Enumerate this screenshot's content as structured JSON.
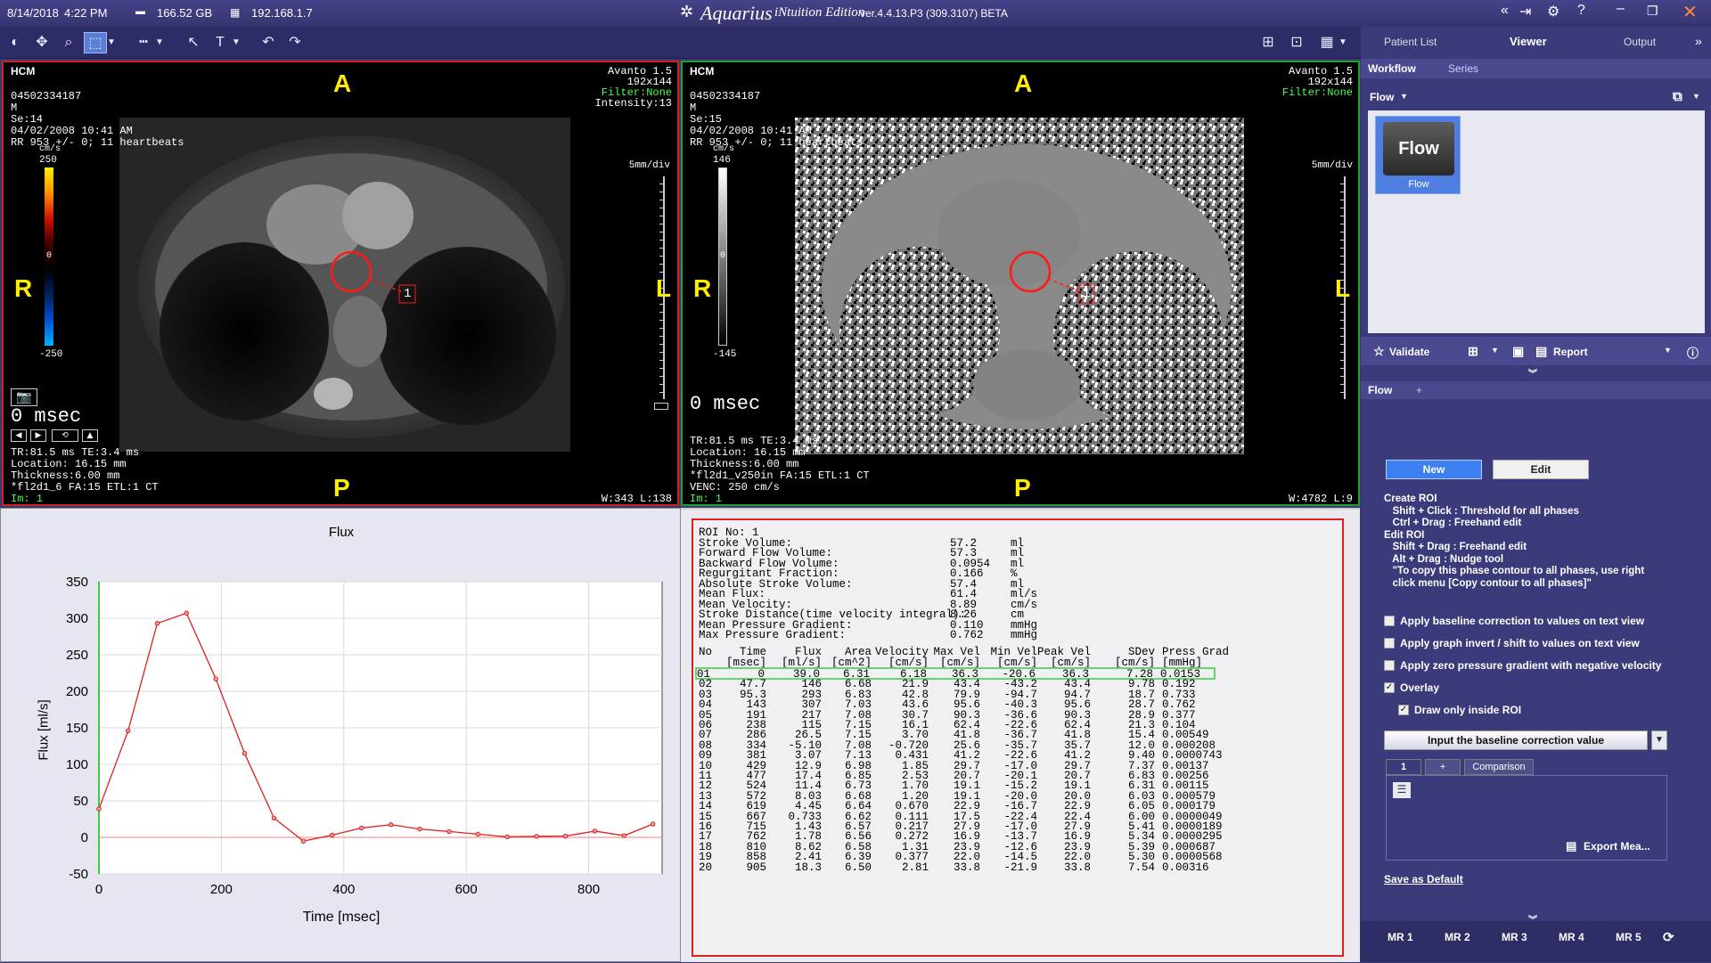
{
  "topbar": {
    "date": "8/14/2018",
    "time": "4:22 PM",
    "disk": "166.52 GB",
    "ip": "192.168.1.7",
    "app_title": "Aquarius",
    "app_sub": "iNtuition Edition",
    "version": "ver.4.4.13.P3 (309.3107) BETA"
  },
  "nav_tabs": {
    "patient_list": "Patient List",
    "viewer": "Viewer",
    "output": "Output"
  },
  "vp1": {
    "title": "HCM",
    "id": "04502334187",
    "sex": "M",
    "se": "Se:14",
    "date": "04/02/2008 10:41 AM",
    "rr": "RR 953 +/- 0; 11 heartbeats",
    "unit": "cm/s",
    "scale_top": "250",
    "scale_mid": "0",
    "scale_bot": "-250",
    "device": "Avanto 1.5",
    "matrix": "192x144",
    "filter": "Filter:None",
    "intensity": "Intensity:13",
    "msec": "0 msec",
    "tr": "TR:81.5 ms TE:3.4 ms",
    "location": "Location: 16.15 mm",
    "thickness": "Thickness:6.00 mm",
    "seq": "*fl2d1_6 FA:15 ETL:1 CT",
    "im": "Im: 1",
    "wl": "W:343 L:138",
    "scale_label": "5mm/div",
    "A": "A",
    "P": "P",
    "R": "R",
    "L": "L",
    "roi": "1"
  },
  "vp2": {
    "title": "HCM",
    "id": "04502334187",
    "sex": "M",
    "se": "Se:15",
    "date": "04/02/2008 10:41 AM",
    "rr": "RR 953 +/- 0; 11 heartbeats",
    "unit": "cm/s",
    "scale_top": "146",
    "scale_mid": "0",
    "scale_bot": "-145",
    "device": "Avanto 1.5",
    "matrix": "192x144",
    "filter": "Filter:None",
    "msec": "0 msec",
    "tr": "TR:81.5 ms TE:3.4 ms",
    "location": "Location: 16.15 mm",
    "thickness": "Thickness:6.00 mm",
    "seq": "*fl2d1_v250in FA:15 ETL:1 CT",
    "venc": "VENC: 250 cm/s",
    "im": "Im: 1",
    "wl": "W:4782 L:9",
    "scale_label": "5mm/div",
    "A": "A",
    "P": "P",
    "R": "R",
    "L": "L",
    "roi": "1"
  },
  "chart_data": {
    "type": "line",
    "title": "Flux",
    "xlabel": "Time [msec]",
    "ylabel": "Flux [ml/s]",
    "xlim": [
      0,
      920
    ],
    "ylim": [
      -50,
      350
    ],
    "xticks": [
      0,
      200,
      400,
      600,
      800
    ],
    "yticks": [
      -50,
      0,
      50,
      100,
      150,
      200,
      250,
      300,
      350
    ],
    "x": [
      0,
      47.7,
      95.3,
      143,
      191,
      238,
      286,
      334,
      381,
      429,
      477,
      524,
      572,
      619,
      667,
      715,
      762,
      810,
      858,
      905
    ],
    "series": [
      {
        "values": [
          39.0,
          146,
          293,
          307,
          217,
          115,
          26.5,
          -5.1,
          3.07,
          12.9,
          17.4,
          11.4,
          8.03,
          4.45,
          0.733,
          1.43,
          1.78,
          8.62,
          2.41,
          18.3
        ]
      }
    ]
  },
  "stats": [
    {
      "label": "ROI No: 1",
      "value": "",
      "unit": ""
    },
    {
      "label": "Stroke Volume:",
      "value": "57.2",
      "unit": "ml"
    },
    {
      "label": "Forward Flow Volume:",
      "value": "57.3",
      "unit": "ml"
    },
    {
      "label": "Backward Flow Volume:",
      "value": "0.0954",
      "unit": "ml"
    },
    {
      "label": "Regurgitant Fraction:",
      "value": "0.166",
      "unit": "%"
    },
    {
      "label": "Absolute Stroke Volume:",
      "value": "57.4",
      "unit": "ml"
    },
    {
      "label": "Mean Flux:",
      "value": "61.4",
      "unit": "ml/s"
    },
    {
      "label": "Mean Velocity:",
      "value": "8.89",
      "unit": "cm/s"
    },
    {
      "label": "Stroke Distance(time velocity integral):",
      "value": "8.26",
      "unit": "cm"
    },
    {
      "label": "Mean Pressure Gradient:",
      "value": "0.110",
      "unit": "mmHg"
    },
    {
      "label": "Max Pressure Gradient:",
      "value": "0.762",
      "unit": "mmHg"
    }
  ],
  "table": {
    "headers": [
      "No",
      "Time",
      "Flux",
      "Area",
      "Velocity",
      "Max Vel",
      "Min Vel",
      "Peak Vel",
      "SDev",
      "Press Grad"
    ],
    "units": [
      "",
      "[msec]",
      "[ml/s]",
      "[cm^2]",
      "[cm/s]",
      "[cm/s]",
      "[cm/s]",
      "[cm/s]",
      "[cm/s]",
      "[mmHg]"
    ],
    "rows": [
      [
        "01",
        "0",
        "39.0",
        "6.31",
        "6.18",
        "36.3",
        "-20.6",
        "36.3",
        "7.28",
        "0.0153"
      ],
      [
        "02",
        "47.7",
        "146",
        "6.68",
        "21.9",
        "43.4",
        "-43.2",
        "43.4",
        "9.78",
        "0.192"
      ],
      [
        "03",
        "95.3",
        "293",
        "6.83",
        "42.8",
        "79.9",
        "-94.7",
        "94.7",
        "18.7",
        "0.733"
      ],
      [
        "04",
        "143",
        "307",
        "7.03",
        "43.6",
        "95.6",
        "-40.3",
        "95.6",
        "28.7",
        "0.762"
      ],
      [
        "05",
        "191",
        "217",
        "7.08",
        "30.7",
        "90.3",
        "-36.6",
        "90.3",
        "28.9",
        "0.377"
      ],
      [
        "06",
        "238",
        "115",
        "7.15",
        "16.1",
        "62.4",
        "-22.6",
        "62.4",
        "21.3",
        "0.104"
      ],
      [
        "07",
        "286",
        "26.5",
        "7.15",
        "3.70",
        "41.8",
        "-36.7",
        "41.8",
        "15.4",
        "0.00549"
      ],
      [
        "08",
        "334",
        "-5.10",
        "7.08",
        "-0.720",
        "25.6",
        "-35.7",
        "35.7",
        "12.0",
        "0.000208"
      ],
      [
        "09",
        "381",
        "3.07",
        "7.13",
        "0.431",
        "41.2",
        "-22.6",
        "41.2",
        "9.40",
        "0.0000743"
      ],
      [
        "10",
        "429",
        "12.9",
        "6.98",
        "1.85",
        "29.7",
        "-17.0",
        "29.7",
        "7.37",
        "0.00137"
      ],
      [
        "11",
        "477",
        "17.4",
        "6.85",
        "2.53",
        "20.7",
        "-20.1",
        "20.7",
        "6.83",
        "0.00256"
      ],
      [
        "12",
        "524",
        "11.4",
        "6.73",
        "1.70",
        "19.1",
        "-15.2",
        "19.1",
        "6.31",
        "0.00115"
      ],
      [
        "13",
        "572",
        "8.03",
        "6.68",
        "1.20",
        "19.1",
        "-20.0",
        "20.0",
        "6.03",
        "0.000579"
      ],
      [
        "14",
        "619",
        "4.45",
        "6.64",
        "0.670",
        "22.9",
        "-16.7",
        "22.9",
        "6.05",
        "0.000179"
      ],
      [
        "15",
        "667",
        "0.733",
        "6.62",
        "0.111",
        "17.5",
        "-22.4",
        "22.4",
        "6.00",
        "0.0000049"
      ],
      [
        "16",
        "715",
        "1.43",
        "6.57",
        "0.217",
        "27.9",
        "-17.0",
        "27.9",
        "5.41",
        "0.0000189"
      ],
      [
        "17",
        "762",
        "1.78",
        "6.56",
        "0.272",
        "16.9",
        "-13.7",
        "16.9",
        "5.34",
        "0.0000295"
      ],
      [
        "18",
        "810",
        "8.62",
        "6.58",
        "1.31",
        "23.9",
        "-12.6",
        "23.9",
        "5.39",
        "0.000687"
      ],
      [
        "19",
        "858",
        "2.41",
        "6.39",
        "0.377",
        "22.0",
        "-14.5",
        "22.0",
        "5.30",
        "0.0000568"
      ],
      [
        "20",
        "905",
        "18.3",
        "6.50",
        "2.81",
        "33.8",
        "-21.9",
        "33.8",
        "7.54",
        "0.00316"
      ]
    ]
  },
  "side": {
    "workflow_tab": "Workflow",
    "series_tab": "Series",
    "flow_dropdown": "Flow",
    "flow_tile": "Flow",
    "flow_tile_label": "Flow",
    "validate": "Validate",
    "report": "Report",
    "flow_section": "Flow",
    "plus": "+",
    "new_btn": "New",
    "edit_btn": "Edit",
    "help": [
      "Create ROI",
      "   Shift + Click : Threshold for all phases",
      "   Ctrl + Drag : Freehand edit",
      "Edit ROI",
      "   Shift + Drag : Freehand edit",
      "   Alt + Drag : Nudge tool",
      "   \"To copy this phase contour to all phases, use right",
      "   click menu [Copy contour to all phases]\""
    ],
    "opt1": "Apply baseline correction to values on text view",
    "opt2": "Apply graph invert / shift to values on text view",
    "opt3": "Apply zero pressure gradient with negative velocity",
    "opt4": "Overlay",
    "opt5": "Draw only inside ROI",
    "baseline_btn": "Input the baseline correction value",
    "tab1": "1",
    "tab_plus": "+",
    "tab_comparison": "Comparison",
    "export": "Export Mea...",
    "save_default": "Save as Default",
    "mr": [
      "MR 1",
      "MR 2",
      "MR 3",
      "MR 4",
      "MR 5"
    ]
  }
}
